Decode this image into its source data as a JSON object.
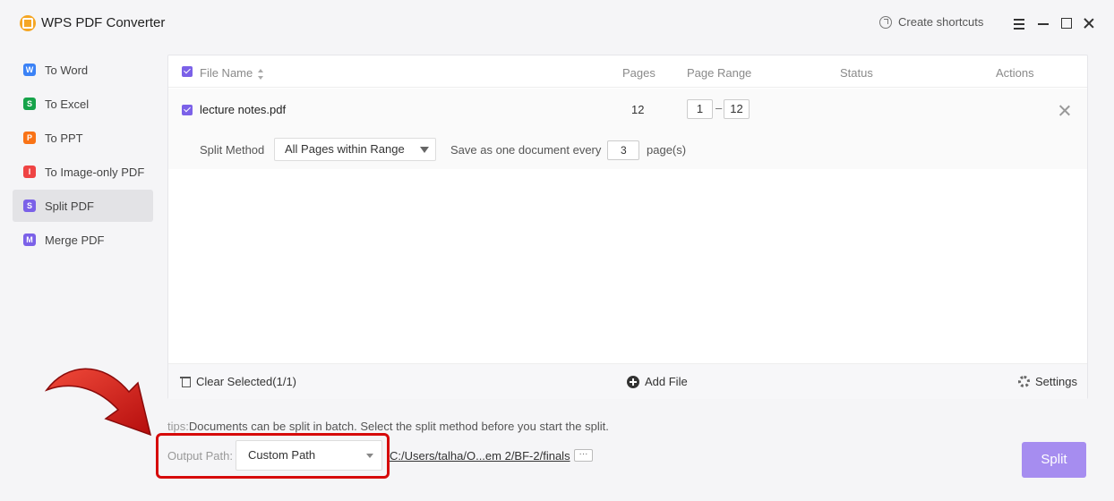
{
  "app": {
    "title": "WPS PDF Converter",
    "create_shortcuts": "Create shortcuts"
  },
  "sidebar": {
    "items": [
      {
        "label": "To Word",
        "icon": "W",
        "color": "#3b82f6"
      },
      {
        "label": "To Excel",
        "icon": "S",
        "color": "#16a34a"
      },
      {
        "label": "To PPT",
        "icon": "P",
        "color": "#f97316"
      },
      {
        "label": "To Image-only PDF",
        "icon": "I",
        "color": "#ef4444"
      },
      {
        "label": "Split PDF",
        "icon": "S",
        "color": "#7b61e8",
        "active": true
      },
      {
        "label": "Merge PDF",
        "icon": "M",
        "color": "#7b61e8"
      }
    ]
  },
  "table": {
    "headers": {
      "file_name": "File Name",
      "pages": "Pages",
      "page_range": "Page Range",
      "status": "Status",
      "actions": "Actions"
    },
    "row": {
      "file_name": "lecture notes.pdf",
      "pages": "12",
      "range_from": "1",
      "range_sep": "–",
      "range_to": "12",
      "split_method_label": "Split Method",
      "split_method_value": "All Pages within Range",
      "save_every_label": "Save as one document every",
      "save_every_value": "3",
      "page_unit": "page(s)"
    }
  },
  "footer": {
    "clear_selected": "Clear Selected(1/1)",
    "add_file": "Add File",
    "settings": "Settings"
  },
  "tips": {
    "label": "tips:",
    "text": "Documents can be split in batch. Select the split method before you start the split."
  },
  "output": {
    "label": "Output Path:",
    "mode": "Custom Path",
    "path": "C:/Users/talha/O...em 2/BF-2/finals",
    "browse": "···"
  },
  "actions": {
    "split": "Split"
  },
  "colors": {
    "accent": "#7b61e8",
    "split_button": "#a68df0",
    "annotation": "#d60a0a"
  }
}
